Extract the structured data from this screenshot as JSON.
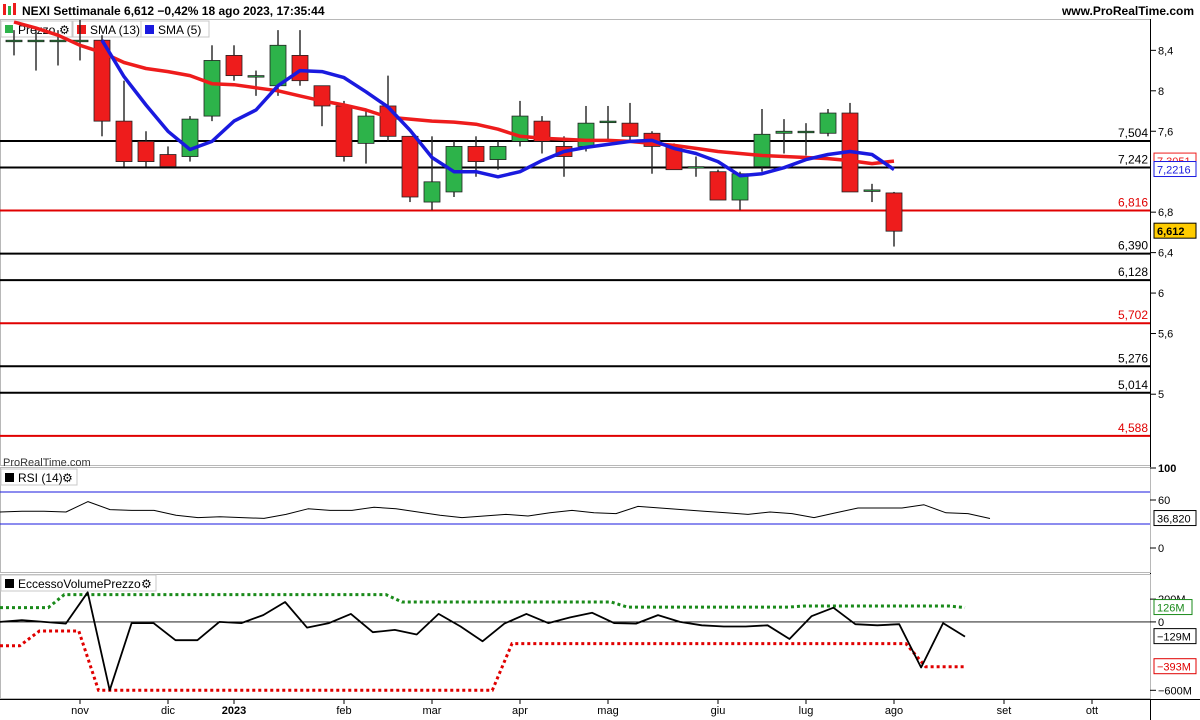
{
  "header": {
    "title": "NEXI Settimanale 6,612 −0,42% 18 ago 2023, 17:35:44",
    "site": "www.ProRealTime.com"
  },
  "legend": {
    "price": "Prezzo",
    "sma13": "SMA (13)",
    "sma5": "SMA (5)",
    "rsi": "RSI (14)",
    "evp": "EccessoVolumePrezzo",
    "watermark": "ProRealTime.com"
  },
  "colors": {
    "up": "#2db34a",
    "down": "#ee1c1c",
    "sma13": "#ee1c1c",
    "sma5": "#1a1adf",
    "level_black": "#000000",
    "level_red": "#e00000",
    "axis_price_label": "#ffcc00"
  },
  "chart_data": [
    {
      "type": "candlestick",
      "name": "Prezzo",
      "ylim": [
        4.3,
        8.7
      ],
      "y_ticks": [
        "8,4",
        "8",
        "7,6",
        "6,8",
        "6,4",
        "6",
        "5,6",
        "5"
      ],
      "y_tick_values": [
        8.4,
        8.0,
        7.6,
        6.8,
        6.4,
        6.0,
        5.6,
        5.0
      ],
      "x_ticks": [
        "nov",
        "dic",
        "2023",
        "feb",
        "mar",
        "apr",
        "mag",
        "giu",
        "lug",
        "ago",
        "set",
        "ott"
      ],
      "x_tick_week_index": [
        0,
        4,
        7,
        12,
        16,
        20,
        24,
        29,
        33,
        37,
        42,
        46
      ],
      "candles": [
        {
          "o": 8.5,
          "h": 8.6,
          "l": 8.35,
          "c": 8.5
        },
        {
          "o": 8.5,
          "h": 8.6,
          "l": 8.2,
          "c": 8.5
        },
        {
          "o": 8.5,
          "h": 8.6,
          "l": 8.25,
          "c": 8.5
        },
        {
          "o": 8.5,
          "h": 8.7,
          "l": 8.3,
          "c": 8.5
        },
        {
          "o": 8.5,
          "h": 8.55,
          "l": 7.55,
          "c": 7.7
        },
        {
          "o": 7.7,
          "h": 8.1,
          "l": 7.25,
          "c": 7.3
        },
        {
          "o": 7.5,
          "h": 7.6,
          "l": 7.25,
          "c": 7.3
        },
        {
          "o": 7.37,
          "h": 7.45,
          "l": 7.25,
          "c": 7.25
        },
        {
          "o": 7.35,
          "h": 7.75,
          "l": 7.3,
          "c": 7.72
        },
        {
          "o": 7.75,
          "h": 8.45,
          "l": 7.7,
          "c": 8.3
        },
        {
          "o": 8.35,
          "h": 8.45,
          "l": 8.1,
          "c": 8.15
        },
        {
          "o": 8.15,
          "h": 8.2,
          "l": 7.95,
          "c": 8.15
        },
        {
          "o": 8.05,
          "h": 8.6,
          "l": 7.95,
          "c": 8.45
        },
        {
          "o": 8.35,
          "h": 8.6,
          "l": 8.05,
          "c": 8.1
        },
        {
          "o": 8.05,
          "h": 8.05,
          "l": 7.65,
          "c": 7.85
        },
        {
          "o": 7.85,
          "h": 7.9,
          "l": 7.3,
          "c": 7.35
        },
        {
          "o": 7.48,
          "h": 7.8,
          "l": 7.28,
          "c": 7.75
        },
        {
          "o": 7.85,
          "h": 8.15,
          "l": 7.5,
          "c": 7.55
        },
        {
          "o": 7.55,
          "h": 7.55,
          "l": 6.9,
          "c": 6.95
        },
        {
          "o": 6.9,
          "h": 7.55,
          "l": 6.82,
          "c": 7.1
        },
        {
          "o": 7.0,
          "h": 7.5,
          "l": 6.95,
          "c": 7.45
        },
        {
          "o": 7.45,
          "h": 7.55,
          "l": 7.15,
          "c": 7.3
        },
        {
          "o": 7.32,
          "h": 7.5,
          "l": 7.22,
          "c": 7.45
        },
        {
          "o": 7.5,
          "h": 7.9,
          "l": 7.45,
          "c": 7.75
        },
        {
          "o": 7.7,
          "h": 7.75,
          "l": 7.38,
          "c": 7.5
        },
        {
          "o": 7.45,
          "h": 7.55,
          "l": 7.15,
          "c": 7.35
        },
        {
          "o": 7.45,
          "h": 7.85,
          "l": 7.4,
          "c": 7.68
        },
        {
          "o": 7.7,
          "h": 7.85,
          "l": 7.5,
          "c": 7.7
        },
        {
          "o": 7.68,
          "h": 7.88,
          "l": 7.5,
          "c": 7.55
        },
        {
          "o": 7.58,
          "h": 7.6,
          "l": 7.18,
          "c": 7.45
        },
        {
          "o": 7.45,
          "h": 7.48,
          "l": 7.22,
          "c": 7.22
        },
        {
          "o": 7.25,
          "h": 7.35,
          "l": 7.15,
          "c": 7.25
        },
        {
          "o": 7.2,
          "h": 7.22,
          "l": 6.92,
          "c": 6.92
        },
        {
          "o": 6.92,
          "h": 7.2,
          "l": 6.82,
          "c": 7.18
        },
        {
          "o": 7.25,
          "h": 7.82,
          "l": 7.2,
          "c": 7.57
        },
        {
          "o": 7.58,
          "h": 7.72,
          "l": 7.38,
          "c": 7.6
        },
        {
          "o": 7.6,
          "h": 7.68,
          "l": 7.36,
          "c": 7.6
        },
        {
          "o": 7.58,
          "h": 7.82,
          "l": 7.55,
          "c": 7.78
        },
        {
          "o": 7.78,
          "h": 7.88,
          "l": 7.02,
          "c": 7.0
        },
        {
          "o": 7.02,
          "h": 7.08,
          "l": 6.9,
          "c": 7.02
        },
        {
          "o": 6.99,
          "h": 7.0,
          "l": 6.46,
          "c": 6.612
        }
      ],
      "sma13": [
        8.68,
        8.62,
        8.55,
        8.45,
        8.38,
        8.28,
        8.22,
        8.19,
        8.15,
        8.07,
        8.06,
        8.03,
        8.0,
        7.95,
        7.9,
        7.86,
        7.81,
        7.74,
        7.72,
        7.7,
        7.69,
        7.67,
        7.62,
        7.55,
        7.53,
        7.52,
        7.51,
        7.51,
        7.5,
        7.48,
        7.46,
        7.43,
        7.4,
        7.38,
        7.36,
        7.35,
        7.34,
        7.33,
        7.31,
        7.28,
        7.3051
      ],
      "sma5": [
        null,
        null,
        null,
        null,
        8.5,
        8.14,
        7.86,
        7.6,
        7.42,
        7.5,
        7.7,
        7.81,
        8.05,
        8.2,
        8.19,
        8.13,
        7.99,
        7.84,
        7.61,
        7.34,
        7.2,
        7.2,
        7.15,
        7.2,
        7.31,
        7.4,
        7.44,
        7.47,
        7.5,
        7.51,
        7.43,
        7.38,
        7.3,
        7.16,
        7.18,
        7.24,
        7.32,
        7.37,
        7.4,
        7.37,
        7.2216
      ],
      "levels": [
        {
          "value": "7,504",
          "v": 7.504,
          "color": "black"
        },
        {
          "value": "7,242",
          "v": 7.242,
          "color": "black"
        },
        {
          "value": "6,816",
          "v": 6.816,
          "color": "red"
        },
        {
          "value": "6,390",
          "v": 6.39,
          "color": "black"
        },
        {
          "value": "6,128",
          "v": 6.128,
          "color": "black"
        },
        {
          "value": "5,702",
          "v": 5.702,
          "color": "red"
        },
        {
          "value": "5,276",
          "v": 5.276,
          "color": "black"
        },
        {
          "value": "5,014",
          "v": 5.014,
          "color": "black"
        },
        {
          "value": "4,588",
          "v": 4.588,
          "color": "red"
        }
      ],
      "last_labels": {
        "sma13": "7,3051",
        "sma5": "7,2216",
        "price": "6,612"
      }
    },
    {
      "type": "line",
      "name": "RSI (14)",
      "ylim": [
        0,
        100
      ],
      "y_ticks": [
        "100",
        "60",
        "0"
      ],
      "y_tick_values": [
        100,
        60,
        0
      ],
      "bands": [
        70,
        30
      ],
      "values": [
        45,
        46,
        46,
        45,
        58,
        48,
        47,
        47,
        41,
        38,
        39,
        38,
        37,
        42,
        49,
        47,
        47,
        51,
        49,
        45,
        41,
        38,
        40,
        42,
        40,
        44,
        47,
        44,
        43,
        52,
        50,
        48,
        46,
        44,
        42,
        45,
        43,
        38,
        44,
        50,
        50,
        50,
        54,
        44,
        43,
        36.82
      ],
      "last_label": "36,820"
    },
    {
      "type": "line",
      "name": "EccessoVolumePrezzo",
      "ylim": [
        -650,
        280
      ],
      "y_ticks": [
        "200M",
        "0",
        "−600M"
      ],
      "y_tick_values": [
        200,
        0,
        -600
      ],
      "values": [
        0,
        15,
        0,
        -15,
        260,
        -600,
        -10,
        -10,
        -160,
        -160,
        0,
        -10,
        60,
        175,
        -50,
        -10,
        70,
        -90,
        -70,
        -110,
        70,
        -40,
        -170,
        -15,
        70,
        -10,
        40,
        80,
        -10,
        -15,
        60,
        0,
        -30,
        -40,
        -40,
        -30,
        -150,
        50,
        125,
        -20,
        -30,
        -20,
        -400,
        -10,
        -129
      ],
      "upper": [
        126,
        126,
        126,
        126,
        240,
        240,
        240,
        240,
        240,
        240,
        240,
        240,
        240,
        240,
        240,
        240,
        240,
        240,
        240,
        240,
        240,
        240,
        240,
        240,
        240,
        175,
        175,
        175,
        175,
        175,
        175,
        175,
        175,
        175,
        175,
        175,
        175,
        175,
        175,
        130,
        130,
        130,
        130,
        130,
        130,
        130,
        130,
        130,
        130,
        130,
        140,
        140,
        140,
        140,
        140,
        140,
        140,
        140,
        140,
        140,
        126
      ],
      "lower": [
        -210,
        -210,
        -80,
        -80,
        -80,
        -600,
        -600,
        -600,
        -600,
        -600,
        -600,
        -600,
        -600,
        -600,
        -600,
        -600,
        -600,
        -600,
        -600,
        -600,
        -600,
        -600,
        -600,
        -600,
        -600,
        -600,
        -190,
        -190,
        -190,
        -190,
        -190,
        -190,
        -190,
        -190,
        -190,
        -190,
        -190,
        -190,
        -190,
        -190,
        -190,
        -190,
        -190,
        -190,
        -190,
        -190,
        -190,
        -393,
        -393,
        -393
      ],
      "last_labels": {
        "upper": "126M",
        "value": "−129M",
        "lower": "−393M"
      }
    }
  ]
}
